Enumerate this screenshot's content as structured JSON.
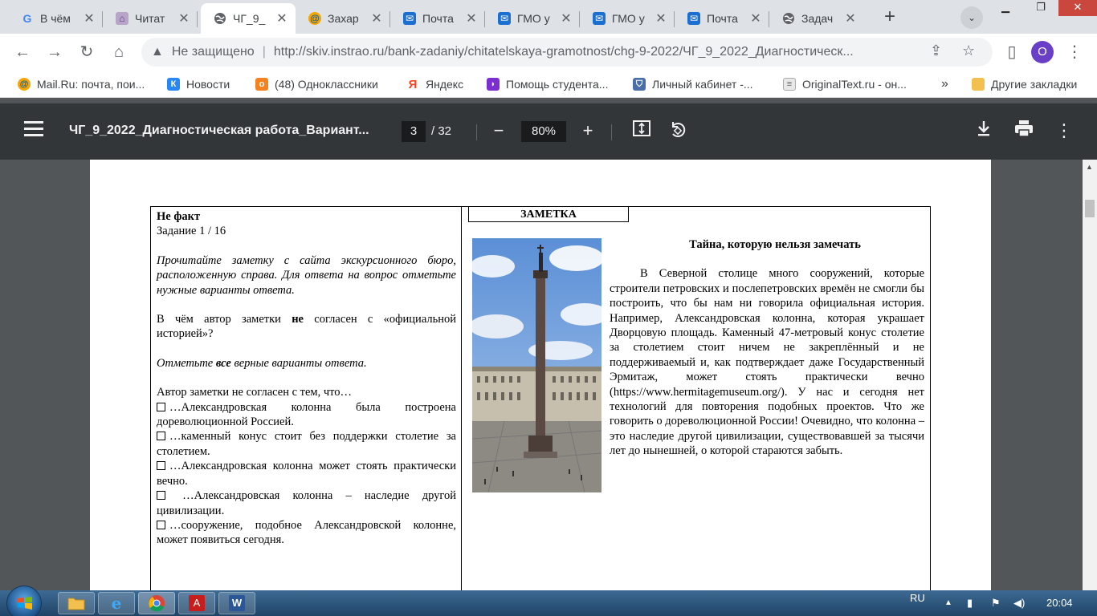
{
  "browser": {
    "tabs": [
      {
        "title": "В чём",
        "favicon": "google-icon",
        "active": false
      },
      {
        "title": "Читат",
        "favicon": "site-icon",
        "active": false
      },
      {
        "title": "ЧГ_9_",
        "favicon": "globe-icon",
        "active": true
      },
      {
        "title": "Захар",
        "favicon": "mailru-icon",
        "active": false
      },
      {
        "title": "Почта",
        "favicon": "mail-icon",
        "active": false
      },
      {
        "title": "ГМО у",
        "favicon": "mail-icon",
        "active": false
      },
      {
        "title": "ГМО у",
        "favicon": "mail-icon",
        "active": false
      },
      {
        "title": "Почта",
        "favicon": "mail-icon",
        "active": false
      },
      {
        "title": "Задач",
        "favicon": "globe-icon",
        "active": false
      }
    ],
    "address": {
      "security_label": "Не защищено",
      "url": "http://skiv.instrao.ru/bank-zadaniy/chitatelskaya-gramotnost/chg-9-2022/ЧГ_9_2022_Диагностическ..."
    },
    "profile_initial": "О",
    "bookmarks": [
      {
        "label": "Mail.Ru: почта, пои...",
        "icon": "mailru-icon"
      },
      {
        "label": "Новости",
        "icon": "vk-icon"
      },
      {
        "label": "(48) Одноклассники",
        "icon": "ok-icon"
      },
      {
        "label": "Яндекс",
        "icon": "yandex-icon"
      },
      {
        "label": "Помощь студента...",
        "icon": "help-icon"
      },
      {
        "label": "Личный кабинет -...",
        "icon": "shield-icon"
      },
      {
        "label": "OriginalText.ru - он...",
        "icon": "doc-icon"
      }
    ],
    "bookmarks_overflow": "»",
    "other_bookmarks": "Другие закладки"
  },
  "pdf": {
    "title": "ЧГ_9_2022_Диагностическая работа_Вариант...",
    "page_current": "3",
    "page_total": "/ 32",
    "zoom": "80%"
  },
  "document": {
    "task_label": "Не факт",
    "task_number": "Задание 1 / 16",
    "instruction": "Прочитайте заметку с сайта экскурсионного бюро, расположенную справа. Для ответа на вопрос отметьте нужные варианты ответа.",
    "question_before": "В чём автор заметки ",
    "question_bold": "не",
    "question_after": " согласен с «официальной историей»?",
    "mark_before": "Отметьте ",
    "mark_bold": "все",
    "mark_after": " верные варианты ответа.",
    "options_lead": "Автор заметки не согласен с тем, что…",
    "options": [
      "…Александровская колонна была построена дореволюционной Россией.",
      "…каменный конус стоит без поддержки столетие за столетием.",
      "…Александровская колонна может стоять практически вечно.",
      " …Александровская колонна – наследие другой цивилизации.",
      "…сооружение, подобное Александровской колонне, может появиться сегодня."
    ],
    "note_header": "ЗАМЕТКА",
    "article_title": "Тайна, которую нельзя замечать",
    "article_text": "В Северной столице много сооружений, которые строители петровских и послепетровских времён не смогли бы построить, что бы нам ни говорила официальная история. Например, Александровская колонна, которая украшает Дворцовую площадь. Каменный 47-метровый конус столетие за столетием стоит ничем не закреплённый и не поддерживаемый и, как подтверждает даже Государственный Эрмитаж, может стоять практически вечно (https://www.hermitagemuseum.org/). У нас и сегодня нет технологий для повторения подобных проектов. Что же говорить о дореволюционной России! Очевидно, что колонна – это наследие другой цивилизации, существовавшей за тысячи лет до нынешней, о которой стараются забыть."
  },
  "taskbar": {
    "language": "RU",
    "time": "20:04"
  },
  "colors": {
    "pdf_toolbar": "#323639",
    "viewer_bg": "#525659",
    "tabstrip": "#dee1e6",
    "profile": "#6a3fc8"
  }
}
